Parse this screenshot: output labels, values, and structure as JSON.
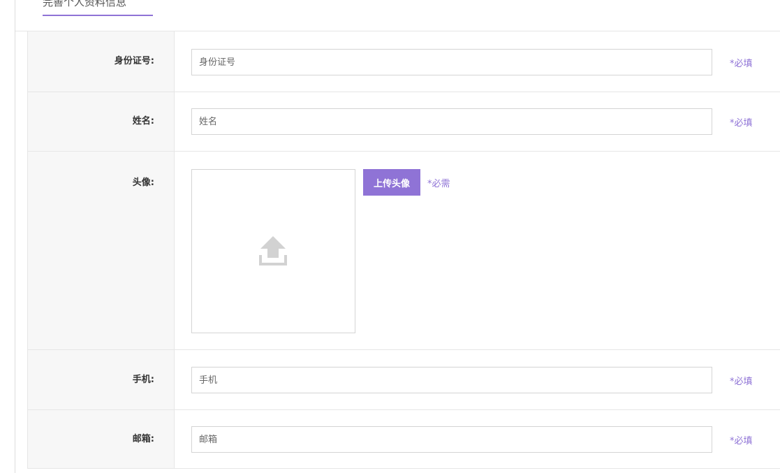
{
  "tab": {
    "label": "完善个人资料信息"
  },
  "colors": {
    "accent": "#8f73d6",
    "border": "#e6e6e6",
    "label_bg": "#f7f7f7"
  },
  "form": {
    "id_card": {
      "label": "身份证号:",
      "placeholder": "身份证号",
      "required": "*必填"
    },
    "name": {
      "label": "姓名:",
      "placeholder": "姓名",
      "required": "*必填"
    },
    "avatar": {
      "label": "头像:",
      "upload_button": "上传头像",
      "required": "*必需",
      "icon": "upload-icon"
    },
    "phone": {
      "label": "手机:",
      "placeholder": "手机",
      "required": "*必填"
    },
    "email": {
      "label": "邮箱:",
      "placeholder": "邮箱",
      "required": "*必填"
    }
  }
}
